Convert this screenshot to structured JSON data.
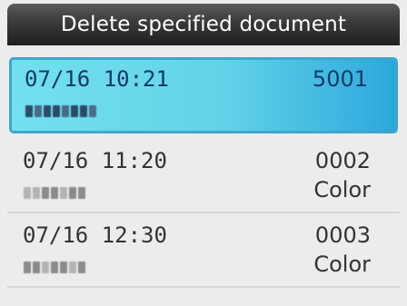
{
  "header": {
    "title": "Delete specified document"
  },
  "documents": [
    {
      "datetime": "07/16 10:21",
      "number": "5001",
      "mode": "",
      "sender_masked": "04540033",
      "selected": true
    },
    {
      "datetime": "07/16 11:20",
      "number": "0002",
      "mode": "Color",
      "sender_masked": "1122333",
      "selected": false
    },
    {
      "datetime": "07/16 12:30",
      "number": "0003",
      "mode": "Color",
      "sender_masked": "3344353",
      "selected": false
    }
  ],
  "colors": {
    "title_bar": "#2d2d2d",
    "selection": "#5fd0e8",
    "background": "#ececec"
  }
}
